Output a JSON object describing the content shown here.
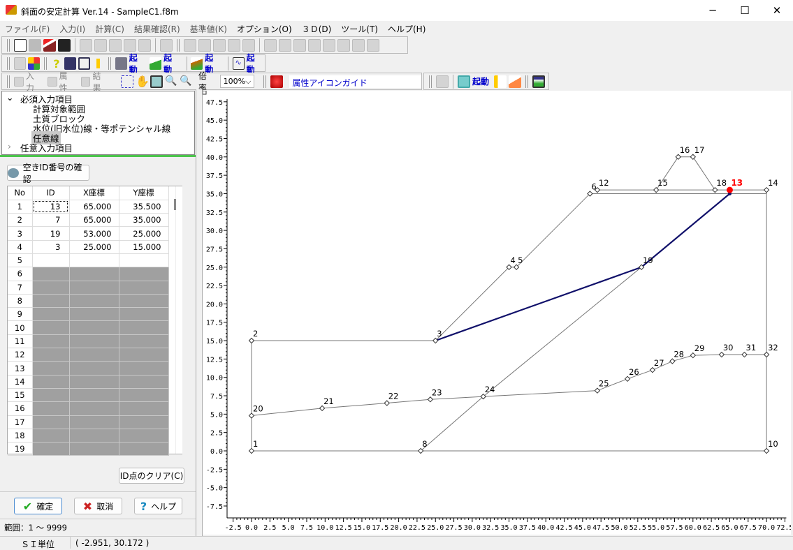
{
  "window": {
    "title": "斜面の安定計算 Ver.14 - SampleC1.f8m",
    "minimize": "─",
    "maximize": "☐",
    "close": "✕"
  },
  "menu": [
    {
      "label": "ファイル(F)",
      "enabled": false
    },
    {
      "label": "入力(I)",
      "enabled": false
    },
    {
      "label": "計算(C)",
      "enabled": false
    },
    {
      "label": "結果確認(R)",
      "enabled": false
    },
    {
      "label": "基準値(K)",
      "enabled": false
    },
    {
      "label": "オプション(O)",
      "enabled": true
    },
    {
      "label": "３Ｄ(D)",
      "enabled": true
    },
    {
      "label": "ツール(T)",
      "enabled": true
    },
    {
      "label": "ヘルプ(H)",
      "enabled": true
    }
  ],
  "toolbar1": [
    "new-file-icon",
    "open-folder-icon",
    "slope-import-icon",
    "save-icon",
    "|",
    "preview-icon",
    "doc-icon",
    "doc-icon",
    "doc-icon",
    "report-icon",
    "|",
    "export-icon",
    "||",
    "tool-icon",
    "tool-icon",
    "check-icon",
    "stairs-icon",
    "house-icon",
    "|",
    "grid-icon",
    "grid-icon",
    "grid-icon",
    "grid-icon",
    "grid-icon",
    "grid-icon",
    "grid-icon",
    "grid-icon"
  ],
  "toolbar2": {
    "launch_label": "起動",
    "icons": [
      "arrows-icon",
      "palette-icon",
      "help-icon",
      "book-icon",
      "card-icon",
      "person-icon"
    ]
  },
  "toolbar3": {
    "input": "入力",
    "attr": "属性",
    "result": "結果",
    "zoom_label": "倍率",
    "zoom_value": "100%",
    "guide": "属性アイコンガイド",
    "launch_label": "起動"
  },
  "colors": {
    "accent": "#0000cc",
    "selected_point": "#ff0000",
    "slip_line": "#10106a",
    "green": "#4cc44c"
  },
  "tree": {
    "required": "必須入力項目",
    "items": [
      "計算対象範囲",
      "土質ブロック",
      "水位(旧水位)線・等ポテンシャル線",
      "任意線"
    ],
    "optional": "任意入力項目"
  },
  "panel": {
    "check_id_button": "空きID番号の確認",
    "clear_button": "ID点のクリア(C)",
    "ok": "確定",
    "cancel": "取消",
    "help": "ヘルプ",
    "range": "範囲：1 ～ 9999"
  },
  "table": {
    "headers": [
      "No",
      "ID",
      "X座標",
      "Y座標"
    ],
    "rows": [
      [
        "1",
        "13",
        "65.000",
        "35.500"
      ],
      [
        "2",
        "7",
        "65.000",
        "35.000"
      ],
      [
        "3",
        "19",
        "53.000",
        "25.000"
      ],
      [
        "4",
        "3",
        "25.000",
        "15.000"
      ],
      [
        "5",
        "",
        "",
        ""
      ],
      [
        "6"
      ],
      [
        "7"
      ],
      [
        "8"
      ],
      [
        "9"
      ],
      [
        "10"
      ],
      [
        "11"
      ],
      [
        "12"
      ],
      [
        "13"
      ],
      [
        "14"
      ],
      [
        "15"
      ],
      [
        "16"
      ],
      [
        "17"
      ],
      [
        "18"
      ],
      [
        "19"
      ]
    ]
  },
  "status": {
    "unit": "ＳＩ単位",
    "coords": "(  -2.951,  30.172 )"
  },
  "chart_data": {
    "type": "scatter",
    "xlim": [
      -2.5,
      72.5
    ],
    "ylim": [
      -7.5,
      47.5
    ],
    "tick_step": 2.5,
    "points": [
      {
        "id": "1",
        "x": 0,
        "y": 0
      },
      {
        "id": "2",
        "x": 0,
        "y": 15
      },
      {
        "id": "3",
        "x": 25,
        "y": 15
      },
      {
        "id": "4",
        "x": 35,
        "y": 25
      },
      {
        "id": "5",
        "x": 36,
        "y": 25
      },
      {
        "id": "6",
        "x": 46,
        "y": 35
      },
      {
        "id": "12",
        "x": 47,
        "y": 35.5
      },
      {
        "id": "15",
        "x": 55,
        "y": 35.5
      },
      {
        "id": "16",
        "x": 58,
        "y": 40
      },
      {
        "id": "17",
        "x": 60,
        "y": 40
      },
      {
        "id": "18",
        "x": 63,
        "y": 35.5
      },
      {
        "id": "13",
        "x": 65,
        "y": 35.5,
        "selected": true
      },
      {
        "id": "14",
        "x": 70,
        "y": 35.5
      },
      {
        "id": "8",
        "x": 23,
        "y": 0
      },
      {
        "id": "10",
        "x": 70,
        "y": 0
      },
      {
        "id": "19",
        "x": 53,
        "y": 25
      },
      {
        "id": "20",
        "x": 0,
        "y": 4.8
      },
      {
        "id": "21",
        "x": 9.6,
        "y": 5.8
      },
      {
        "id": "22",
        "x": 18.4,
        "y": 6.5
      },
      {
        "id": "23",
        "x": 24.3,
        "y": 7
      },
      {
        "id": "24",
        "x": 31.5,
        "y": 7.4
      },
      {
        "id": "25",
        "x": 47,
        "y": 8.2
      },
      {
        "id": "26",
        "x": 51.1,
        "y": 9.8
      },
      {
        "id": "27",
        "x": 54.5,
        "y": 11
      },
      {
        "id": "28",
        "x": 57.2,
        "y": 12.2
      },
      {
        "id": "29",
        "x": 60,
        "y": 13
      },
      {
        "id": "30",
        "x": 63.9,
        "y": 13.1
      },
      {
        "id": "31",
        "x": 67,
        "y": 13.1
      },
      {
        "id": "32",
        "x": 70,
        "y": 13.1
      }
    ],
    "hidden_points": [
      {
        "x": 47,
        "y": 35
      },
      {
        "x": 70,
        "y": 35
      },
      {
        "x": 65,
        "y": 35
      }
    ],
    "lines": [
      [
        [
          0,
          0
        ],
        [
          23,
          0
        ],
        [
          70,
          0
        ]
      ],
      [
        [
          0,
          0
        ],
        [
          0,
          15
        ],
        [
          25,
          15
        ],
        [
          35,
          25
        ],
        [
          36,
          25
        ],
        [
          46,
          35
        ],
        [
          70,
          35
        ]
      ],
      [
        [
          47,
          35.5
        ],
        [
          55,
          35.5
        ],
        [
          63,
          35.5
        ],
        [
          65,
          35.5
        ],
        [
          70,
          35.5
        ]
      ],
      [
        [
          55,
          35.5
        ],
        [
          58,
          40
        ],
        [
          60,
          40
        ],
        [
          63,
          35.5
        ]
      ],
      [
        [
          70,
          0
        ],
        [
          70,
          35.5
        ]
      ],
      [
        [
          23,
          0
        ],
        [
          31.5,
          7.4
        ],
        [
          53,
          25
        ],
        [
          65,
          35
        ]
      ],
      [
        [
          0,
          4.8
        ],
        [
          9.6,
          5.8
        ],
        [
          18.4,
          6.5
        ],
        [
          24.3,
          7
        ],
        [
          31.5,
          7.4
        ],
        [
          47,
          8.2
        ],
        [
          51.1,
          9.8
        ],
        [
          54.5,
          11
        ],
        [
          57.2,
          12.2
        ],
        [
          60,
          13
        ],
        [
          63.9,
          13.1
        ],
        [
          67,
          13.1
        ],
        [
          70,
          13.1
        ]
      ]
    ],
    "arbitrary_line": [
      [
        65,
        35.5
      ],
      [
        65,
        35
      ],
      [
        53,
        25
      ],
      [
        25,
        15
      ]
    ]
  }
}
